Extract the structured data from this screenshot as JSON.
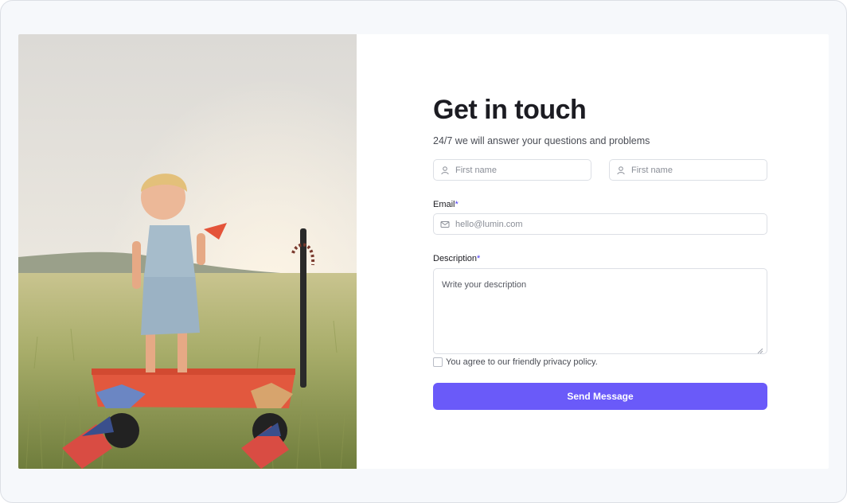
{
  "contact": {
    "title": "Get in touch",
    "subtitle": "24/7 we will answer your questions and problems",
    "first_name_placeholder": "First name",
    "second_name_placeholder": "First name",
    "email_label": "Email",
    "required_mark": "*",
    "email_placeholder": "hello@lumin.com",
    "description_label": "Description",
    "description_placeholder": "Write your description",
    "privacy_text": "You agree to our friendly privacy policy.",
    "privacy_checked": false,
    "send_label": "Send Message"
  },
  "colors": {
    "accent": "#6a5af9",
    "required": "#4b3bf5"
  },
  "icons": {
    "name_field": "user-icon",
    "email_field": "mail-icon"
  }
}
